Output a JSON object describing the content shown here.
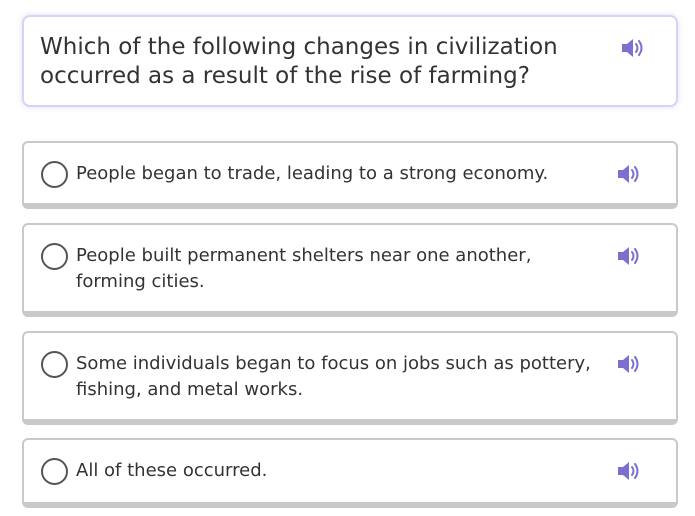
{
  "question": {
    "text": "Which of the following changes in civilization occurred as a result of the rise of farming?",
    "audio_icon": "speaker-icon"
  },
  "options": [
    {
      "label": "People began to trade, leading to a strong economy.",
      "audio_icon": "speaker-icon"
    },
    {
      "label": "People built permanent shelters near one another, forming cities.",
      "audio_icon": "speaker-icon"
    },
    {
      "label": "Some individuals began to focus on jobs such as pottery, fishing, and metal works.",
      "audio_icon": "speaker-icon"
    },
    {
      "label": "All of these occurred.",
      "audio_icon": "speaker-icon"
    }
  ],
  "colors": {
    "speaker": "#7b6fd0",
    "question_border": "#d7d3f3",
    "option_border": "#c9c9c9"
  }
}
